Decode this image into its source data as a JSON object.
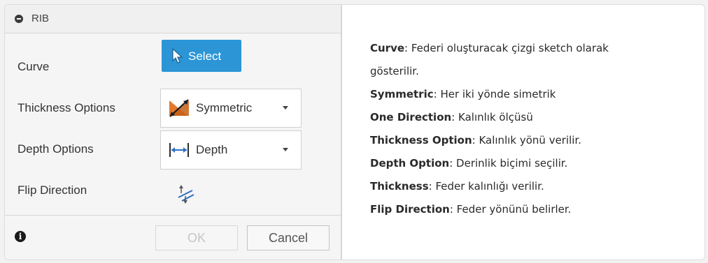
{
  "dialog": {
    "title": "RIB",
    "rows": {
      "curve": {
        "label": "Curve",
        "button_label": "Select"
      },
      "thickness": {
        "label": "Thickness Options",
        "value": "Symmetric"
      },
      "depth": {
        "label": "Depth Options",
        "value": "Depth"
      },
      "flip": {
        "label": "Flip Direction"
      }
    },
    "footer": {
      "ok_label": "OK",
      "cancel_label": "Cancel"
    },
    "icons": {
      "collapse": "minus-circle-icon",
      "cursor": "arrow-cursor-icon",
      "thickness": "symmetric-thickness-icon",
      "depth": "depth-arrow-icon",
      "flip": "flip-direction-icon",
      "info": "info-icon"
    },
    "colors": {
      "select_button": "#2b95d6"
    }
  },
  "description": {
    "items": [
      {
        "term": "Curve",
        "text": ": Federi oluşturacak çizgi sketch olarak",
        "text2": "gösterilir."
      },
      {
        "term": "Symmetric",
        "text": ": Her iki yönde simetrik"
      },
      {
        "term": "One Direction",
        "text": ": Kalınlık ölçüsü"
      },
      {
        "term": "Thickness Option",
        "text": ": Kalınlık yönü verilir."
      },
      {
        "term": "Depth Option",
        "text": ": Derinlik biçimi seçilir."
      },
      {
        "term": "Thickness",
        "text": ": Feder kalınlığı verilir."
      },
      {
        "term": "Flip Direction",
        "text": ": Feder yönünü belirler."
      }
    ]
  }
}
